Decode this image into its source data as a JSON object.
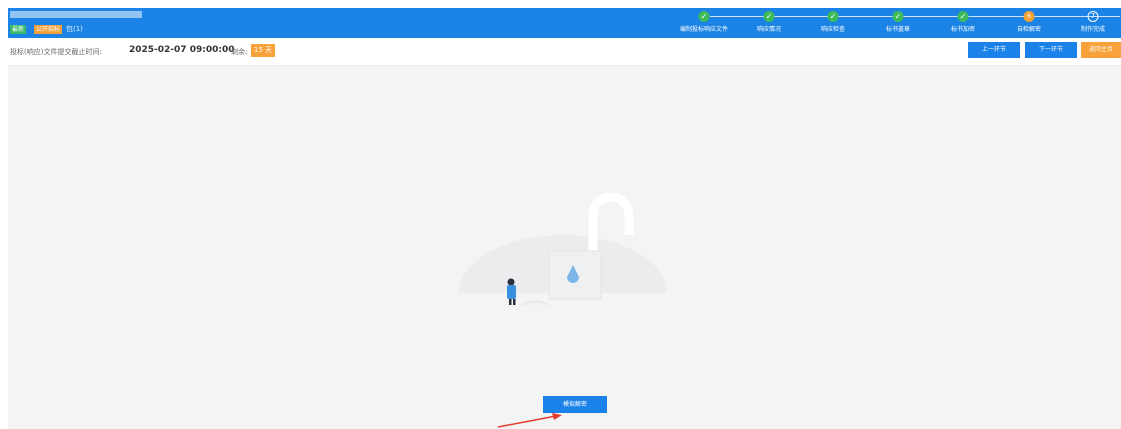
{
  "header": {
    "badge_status": "最新",
    "badge_type": "公开招标",
    "package_text": "包(1)",
    "steps": [
      {
        "label": "编制投标响应文件",
        "state": "done",
        "symbol": "✓"
      },
      {
        "label": "响应情况",
        "state": "done",
        "symbol": "✓"
      },
      {
        "label": "响应检查",
        "state": "done",
        "symbol": "✓"
      },
      {
        "label": "标书盖章",
        "state": "done",
        "symbol": "✓"
      },
      {
        "label": "标书加密",
        "state": "done",
        "symbol": "✓"
      },
      {
        "label": "自检解密",
        "state": "current",
        "symbol": "6"
      },
      {
        "label": "制作完成",
        "state": "todo",
        "symbol": "7"
      }
    ]
  },
  "subbar": {
    "deadline_label": "投标(响应)文件提交截止时间:",
    "deadline_value": "2025-02-07 09:00:00",
    "remain_label": "剩余:",
    "days_remaining": "15 天",
    "prev_button": "上一环节",
    "next_button": "下一环节",
    "home_button": "返回主页"
  },
  "main": {
    "action_button": "模拟解密"
  },
  "colors": {
    "primary": "#1c83e6",
    "success": "#3dbb5a",
    "warning": "#f7a23a",
    "background": "#f4f4f5"
  }
}
